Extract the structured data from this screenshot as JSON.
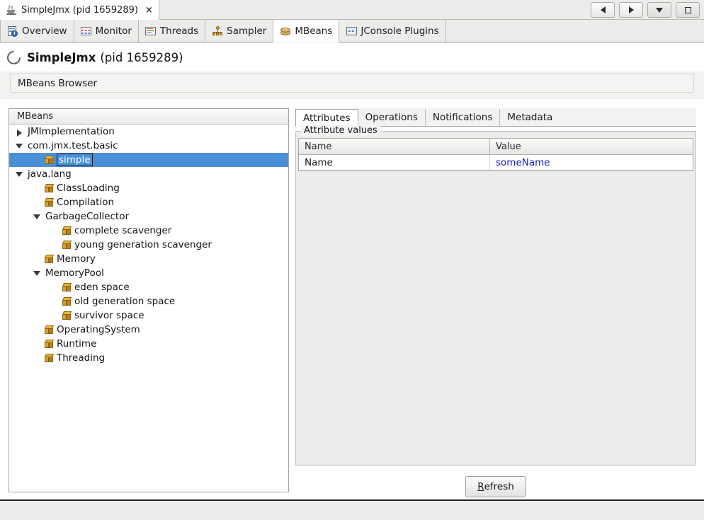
{
  "window": {
    "document_tab": {
      "icon": "java-cup-icon",
      "title": "SimpleJmx (pid 1659289)",
      "close_label": "×"
    },
    "controls": [
      {
        "name": "back-button",
        "icon": "triangle-left-icon"
      },
      {
        "name": "forward-button",
        "icon": "triangle-right-icon"
      },
      {
        "name": "dropdown-button",
        "icon": "triangle-down-icon"
      },
      {
        "name": "maximize-button",
        "icon": "square-maximize-icon"
      }
    ]
  },
  "view_tabs": [
    {
      "label": "Overview",
      "icon": "overview-icon",
      "active": false
    },
    {
      "label": "Monitor",
      "icon": "monitor-icon",
      "active": false
    },
    {
      "label": "Threads",
      "icon": "threads-icon",
      "active": false
    },
    {
      "label": "Sampler",
      "icon": "sampler-icon",
      "active": false
    },
    {
      "label": "MBeans",
      "icon": "mbeans-icon",
      "active": true
    },
    {
      "label": "JConsole Plugins",
      "icon": "jconsole-icon",
      "active": false
    }
  ],
  "app_header": {
    "icon": "process-ring-icon",
    "name": "SimpleJmx",
    "pid": "(pid 1659289)"
  },
  "subheader": {
    "title": "MBeans Browser"
  },
  "tree": {
    "header": "MBeans",
    "nodes": [
      {
        "label": "JMImplementation",
        "depth": 0,
        "type": "folder",
        "state": "collapsed",
        "selected": false
      },
      {
        "label": "com.jmx.test.basic",
        "depth": 0,
        "type": "folder",
        "state": "expanded",
        "selected": false
      },
      {
        "label": "simple",
        "depth": 1,
        "type": "bean",
        "state": "leaf",
        "selected": true
      },
      {
        "label": "java.lang",
        "depth": 0,
        "type": "folder",
        "state": "expanded",
        "selected": false
      },
      {
        "label": "ClassLoading",
        "depth": 1,
        "type": "bean",
        "state": "leaf",
        "selected": false
      },
      {
        "label": "Compilation",
        "depth": 1,
        "type": "bean",
        "state": "leaf",
        "selected": false
      },
      {
        "label": "GarbageCollector",
        "depth": 1,
        "type": "folder",
        "state": "expanded",
        "selected": false
      },
      {
        "label": "complete scavenger",
        "depth": 2,
        "type": "bean",
        "state": "leaf",
        "selected": false
      },
      {
        "label": "young generation scavenger",
        "depth": 2,
        "type": "bean",
        "state": "leaf",
        "selected": false
      },
      {
        "label": "Memory",
        "depth": 1,
        "type": "bean",
        "state": "leaf",
        "selected": false
      },
      {
        "label": "MemoryPool",
        "depth": 1,
        "type": "folder",
        "state": "expanded",
        "selected": false
      },
      {
        "label": "eden space",
        "depth": 2,
        "type": "bean",
        "state": "leaf",
        "selected": false
      },
      {
        "label": "old generation space",
        "depth": 2,
        "type": "bean",
        "state": "leaf",
        "selected": false
      },
      {
        "label": "survivor space",
        "depth": 2,
        "type": "bean",
        "state": "leaf",
        "selected": false
      },
      {
        "label": "OperatingSystem",
        "depth": 1,
        "type": "bean",
        "state": "leaf",
        "selected": false
      },
      {
        "label": "Runtime",
        "depth": 1,
        "type": "bean",
        "state": "leaf",
        "selected": false
      },
      {
        "label": "Threading",
        "depth": 1,
        "type": "bean",
        "state": "leaf",
        "selected": false
      }
    ]
  },
  "detail": {
    "tabs": [
      {
        "label": "Attributes",
        "active": true
      },
      {
        "label": "Operations",
        "active": false
      },
      {
        "label": "Notifications",
        "active": false
      },
      {
        "label": "Metadata",
        "active": false
      }
    ],
    "group_legend": "Attribute values",
    "table": {
      "columns": [
        "Name",
        "Value"
      ],
      "rows": [
        {
          "name": "Name",
          "value": "someName",
          "value_is_link": true
        }
      ]
    },
    "refresh_button": {
      "mnemonic": "R",
      "rest": "efresh"
    }
  },
  "colors": {
    "selection": "#4a90d9",
    "link_value": "#1414d0",
    "panel_bg": "#f2f2f0",
    "white": "#ffffff",
    "bean_icon": "#e8b33c"
  }
}
